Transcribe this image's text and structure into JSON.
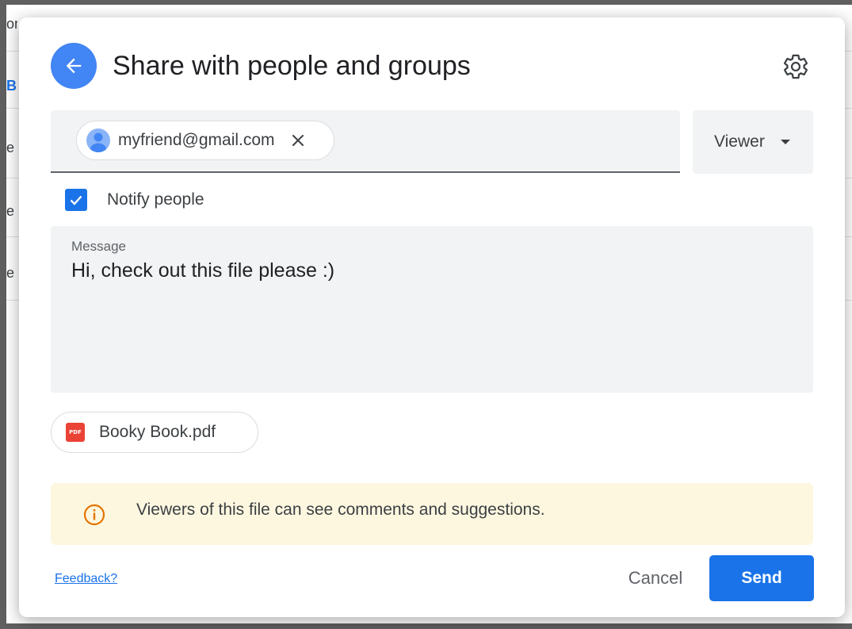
{
  "background": {
    "fragments": [
      {
        "text": "or",
        "color": "dark"
      },
      {
        "text": "B",
        "color": "blue"
      },
      {
        "text": "e",
        "color": "dark"
      },
      {
        "text": "e",
        "color": "dark"
      },
      {
        "text": "e",
        "color": "dark"
      }
    ]
  },
  "dialog": {
    "title": "Share with people and groups",
    "back_icon": "arrow-left-icon",
    "settings_icon": "gear-icon"
  },
  "recipients": {
    "chips": [
      {
        "email": "myfriend@gmail.com"
      }
    ],
    "role": "Viewer"
  },
  "notify": {
    "label": "Notify people",
    "checked": true
  },
  "message": {
    "label": "Message",
    "value": "Hi, check out this file please :)"
  },
  "attachment": {
    "icon_text": "PDF",
    "name": "Booky Book.pdf"
  },
  "info": {
    "icon": "info-icon",
    "text": "Viewers of this file can see comments and suggestions."
  },
  "footer": {
    "feedback_label": "Feedback?",
    "cancel_label": "Cancel",
    "send_label": "Send"
  },
  "colors": {
    "accent": "#1a73e8",
    "back_button": "#4285f4",
    "info_background": "#fef7e0",
    "info_icon": "#e37400",
    "pdf_icon": "#ea4335"
  }
}
